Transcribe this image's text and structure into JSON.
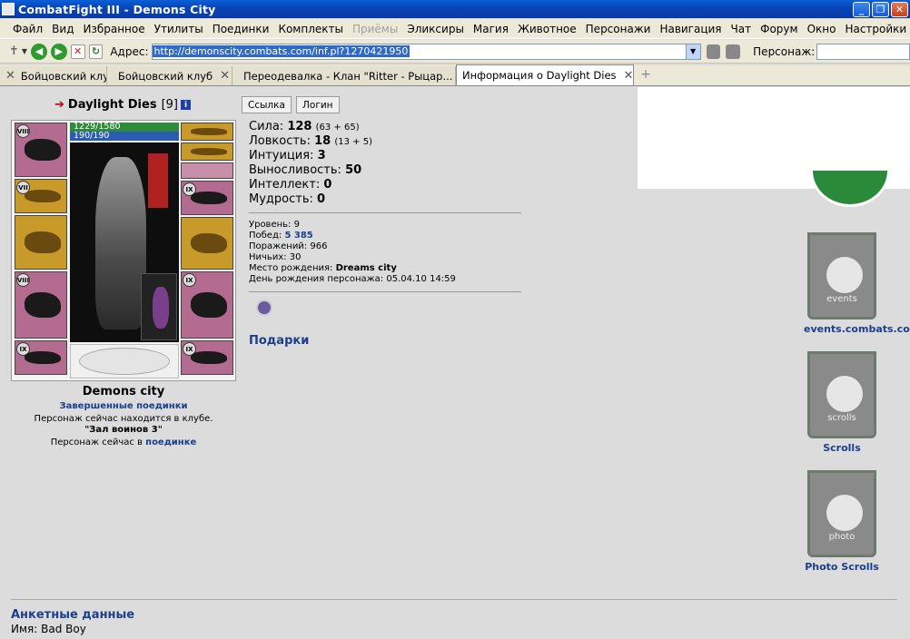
{
  "window": {
    "title": "CombatFight III - Demons City"
  },
  "menu": [
    "Файл",
    "Вид",
    "Избранное",
    "Утилиты",
    "Поединки",
    "Комплекты",
    "Приёмы",
    "Эликсиры",
    "Магия",
    "Животное",
    "Персонажи",
    "Навигация",
    "Чат",
    "Форум",
    "Окно",
    "Настройки",
    "?"
  ],
  "menu_disabled": "Приёмы",
  "address": {
    "label": "Адрес:",
    "url": "http://demonscity.combats.com/inf.pl?1270421950",
    "persona_label": "Персонаж:"
  },
  "tabs": [
    {
      "label": "Бойцовский клуб"
    },
    {
      "label": "Бойцовский клуб"
    },
    {
      "label": "Переодевалка - Клан \"Ritter - Рыцар..."
    },
    {
      "label": "Информация о Daylight Dies"
    }
  ],
  "character": {
    "name": "Daylight Dies",
    "level": "[9]",
    "hp": "1229/1580",
    "mp": "190/190",
    "city": "Demons city",
    "completed_fights": "Завершенные поединки",
    "location_text": "Персонаж сейчас находится в клубе.",
    "location_room": "\"Зал воинов 3\"",
    "in_fight_text": "Персонаж сейчас в",
    "in_fight_link": "поединке",
    "slot_ranks": [
      "VIII",
      "VII",
      "VIII",
      "IX",
      "IX",
      "IX",
      "IX"
    ]
  },
  "buttons": {
    "link": "Ссылка",
    "login": "Логин"
  },
  "stats": [
    {
      "label": "Сила:",
      "value": "128",
      "sub": "(63 + 65)"
    },
    {
      "label": "Ловкость:",
      "value": "18",
      "sub": "(13 + 5)"
    },
    {
      "label": "Интуиция:",
      "value": "3",
      "sub": ""
    },
    {
      "label": "Выносливость:",
      "value": "50",
      "sub": ""
    },
    {
      "label": "Интеллект:",
      "value": "0",
      "sub": ""
    },
    {
      "label": "Мудрость:",
      "value": "0",
      "sub": ""
    }
  ],
  "info": {
    "level_label": "Уровень:",
    "level": "9",
    "wins_label": "Побед:",
    "wins": "5 385",
    "losses_label": "Поражений:",
    "losses": "966",
    "draws_label": "Ничьих:",
    "draws": "30",
    "birthplace_label": "Место рождения:",
    "birthplace": "Dreams city",
    "birthday_label": "День рождения персонажа:",
    "birthday": "05.04.10 14:59"
  },
  "gifts_link": "Подарки",
  "banners": [
    {
      "label": "events",
      "link": "events.combats.com"
    },
    {
      "label": "scrolls",
      "link": "Scrolls"
    },
    {
      "label": "photo",
      "link": "Photo Scrolls"
    }
  ],
  "profile": {
    "section_title": "Анкетные данные",
    "name_label": "Имя:",
    "name_value": "Bad Boy"
  }
}
